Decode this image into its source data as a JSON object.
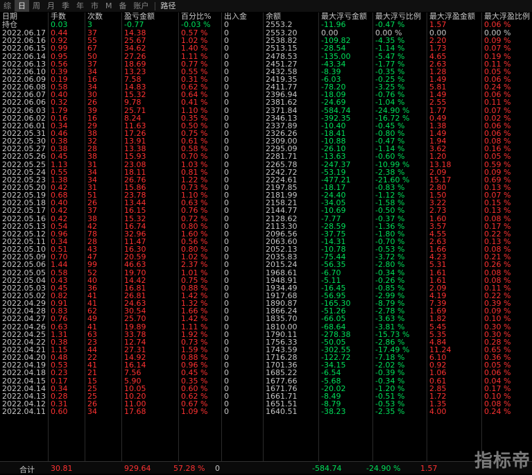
{
  "toolbar": {
    "periods": [
      {
        "label": "综",
        "active": false
      },
      {
        "label": "日",
        "active": true
      },
      {
        "label": "周",
        "active": false
      },
      {
        "label": "月",
        "active": false
      },
      {
        "label": "季",
        "active": false
      },
      {
        "label": "年",
        "active": false
      },
      {
        "label": "市",
        "active": false
      },
      {
        "label": "M",
        "active": false
      },
      {
        "label": "备",
        "active": false
      },
      {
        "label": "账户",
        "active": false
      }
    ],
    "path_label": "路径"
  },
  "headers": [
    "日期",
    "手数",
    "次数",
    "盈亏金额",
    "百分比%",
    "出入金",
    "余额",
    "最大浮亏金额",
    "最大浮亏比例",
    "最大浮盈金额",
    "最大浮盈比例"
  ],
  "holding": {
    "date": "持仓",
    "lots": "0.03",
    "count": "3",
    "pnl": "-0.77",
    "pct": "-0.03 %",
    "flow": "0",
    "balance": "2553.2",
    "max_loss": "-11.96",
    "max_loss_pct": "-0.47 %",
    "max_profit": "1.57",
    "max_profit_pct": "0.06 %"
  },
  "rows": [
    [
      "2022.06.17",
      "0.44",
      "37",
      "14.38",
      "0.57 %",
      "0",
      "2553.20",
      "0.00",
      "0.00 %",
      "0.00",
      "0.00 %"
    ],
    [
      "2022.06.16",
      "0.92",
      "55",
      "25.67",
      "1.02 %",
      "0",
      "2538.82",
      "-109.82",
      "-4.35 %",
      "2.20",
      "0.09 %"
    ],
    [
      "2022.06.15",
      "0.99",
      "67",
      "34.62",
      "1.40 %",
      "0",
      "2513.15",
      "-28.54",
      "-1.14 %",
      "1.73",
      "0.07 %"
    ],
    [
      "2022.06.14",
      "0.95",
      "50",
      "27.26",
      "1.11 %",
      "0",
      "2478.53",
      "-135.00",
      "-5.47 %",
      "4.65",
      "0.19 %"
    ],
    [
      "2022.06.13",
      "0.56",
      "37",
      "18.69",
      "0.77 %",
      "0",
      "2451.27",
      "-43.34",
      "-1.77 %",
      "2.63",
      "0.11 %"
    ],
    [
      "2022.06.10",
      "0.39",
      "34",
      "13.23",
      "0.55 %",
      "0",
      "2432.58",
      "-8.39",
      "-0.35 %",
      "1.28",
      "0.05 %"
    ],
    [
      "2022.06.09",
      "0.19",
      "16",
      "7.58",
      "0.31 %",
      "0",
      "2419.35",
      "-6.03",
      "-0.25 %",
      "1.49",
      "0.06 %"
    ],
    [
      "2022.06.08",
      "0.58",
      "34",
      "14.83",
      "0.62 %",
      "0",
      "2411.77",
      "-78.20",
      "-3.25 %",
      "5.81",
      "0.24 %"
    ],
    [
      "2022.06.07",
      "0.40",
      "30",
      "15.32",
      "0.64 %",
      "0",
      "2396.94",
      "-18.09",
      "-0.76 %",
      "1.49",
      "0.06 %"
    ],
    [
      "2022.06.06",
      "0.32",
      "26",
      "9.78",
      "0.41 %",
      "0",
      "2381.62",
      "-24.69",
      "-1.04 %",
      "2.55",
      "0.11 %"
    ],
    [
      "2022.06.03",
      "1.79",
      "39",
      "25.71",
      "1.10 %",
      "0",
      "2371.84",
      "-584.74",
      "-24.90 %",
      "1.77",
      "0.07 %"
    ],
    [
      "2022.06.02",
      "0.16",
      "16",
      "8.24",
      "0.35 %",
      "0",
      "2346.13",
      "-392.35",
      "-16.72 %",
      "0.49",
      "0.02 %"
    ],
    [
      "2022.06.01",
      "0.34",
      "29",
      "11.63",
      "0.50 %",
      "0",
      "2337.89",
      "-10.40",
      "-0.45 %",
      "1.38",
      "0.06 %"
    ],
    [
      "2022.05.31",
      "0.46",
      "38",
      "17.26",
      "0.75 %",
      "0",
      "2326.26",
      "-18.41",
      "-0.80 %",
      "1.49",
      "0.06 %"
    ],
    [
      "2022.05.30",
      "0.38",
      "32",
      "13.91",
      "0.61 %",
      "0",
      "2309.00",
      "-10.88",
      "-0.47 %",
      "1.94",
      "0.08 %"
    ],
    [
      "2022.05.27",
      "0.38",
      "28",
      "13.38",
      "0.58 %",
      "0",
      "2295.09",
      "-26.10",
      "-1.14 %",
      "3.62",
      "0.16 %"
    ],
    [
      "2022.05.26",
      "0.45",
      "38",
      "15.93",
      "0.70 %",
      "0",
      "2281.71",
      "-13.63",
      "-0.60 %",
      "1.20",
      "0.05 %"
    ],
    [
      "2022.05.25",
      "1.13",
      "31",
      "23.08",
      "1.03 %",
      "0",
      "2265.78",
      "-247.37",
      "-10.99 %",
      "13.18",
      "0.59 %"
    ],
    [
      "2022.05.24",
      "0.55",
      "34",
      "18.11",
      "0.81 %",
      "0",
      "2242.72",
      "-53.19",
      "-2.38 %",
      "2.09",
      "0.09 %"
    ],
    [
      "2022.05.23",
      "1.38",
      "34",
      "26.76",
      "1.22 %",
      "0",
      "2224.61",
      "-477.21",
      "-21.60 %",
      "15.17",
      "0.69 %"
    ],
    [
      "2022.05.20",
      "0.42",
      "31",
      "15.86",
      "0.73 %",
      "0",
      "2197.85",
      "-18.17",
      "-0.83 %",
      "2.80",
      "0.13 %"
    ],
    [
      "2022.05.19",
      "0.68",
      "51",
      "23.78",
      "1.10 %",
      "0",
      "2181.99",
      "-24.40",
      "-1.12 %",
      "1.50",
      "0.07 %"
    ],
    [
      "2022.05.18",
      "0.40",
      "26",
      "13.44",
      "0.63 %",
      "0",
      "2158.21",
      "-34.05",
      "-1.58 %",
      "3.22",
      "0.15 %"
    ],
    [
      "2022.05.17",
      "0.42",
      "37",
      "16.15",
      "0.76 %",
      "0",
      "2144.77",
      "-10.69",
      "-0.50 %",
      "2.73",
      "0.13 %"
    ],
    [
      "2022.05.16",
      "0.42",
      "38",
      "15.32",
      "0.72 %",
      "0",
      "2128.62",
      "-7.77",
      "-0.37 %",
      "1.60",
      "0.08 %"
    ],
    [
      "2022.05.13",
      "0.54",
      "42",
      "16.74",
      "0.80 %",
      "0",
      "2113.30",
      "-28.59",
      "-1.36 %",
      "3.57",
      "0.17 %"
    ],
    [
      "2022.05.12",
      "0.96",
      "78",
      "32.96",
      "1.60 %",
      "0",
      "2096.56",
      "-37.75",
      "-1.80 %",
      "4.55",
      "0.22 %"
    ],
    [
      "2022.05.11",
      "0.34",
      "28",
      "11.47",
      "0.56 %",
      "0",
      "2063.60",
      "-14.31",
      "-0.70 %",
      "2.63",
      "0.13 %"
    ],
    [
      "2022.05.10",
      "0.51",
      "43",
      "16.30",
      "0.80 %",
      "0",
      "2052.13",
      "-10.78",
      "-0.53 %",
      "1.66",
      "0.08 %"
    ],
    [
      "2022.05.09",
      "0.70",
      "47",
      "20.59",
      "1.02 %",
      "0",
      "2035.83",
      "-75.44",
      "-3.72 %",
      "4.23",
      "0.21 %"
    ],
    [
      "2022.05.06",
      "1.44",
      "99",
      "46.63",
      "2.37 %",
      "0",
      "2015.24",
      "-56.35",
      "-2.80 %",
      "5.31",
      "0.26 %"
    ],
    [
      "2022.05.05",
      "0.58",
      "52",
      "19.70",
      "1.01 %",
      "0",
      "1968.61",
      "-6.70",
      "-0.34 %",
      "1.61",
      "0.08 %"
    ],
    [
      "2022.05.04",
      "0.43",
      "40",
      "14.42",
      "0.75 %",
      "0",
      "1948.91",
      "-5.11",
      "-0.26 %",
      "1.61",
      "0.08 %"
    ],
    [
      "2022.05.03",
      "0.45",
      "36",
      "16.81",
      "0.88 %",
      "0",
      "1934.49",
      "-16.45",
      "-0.85 %",
      "2.09",
      "0.11 %"
    ],
    [
      "2022.05.02",
      "0.82",
      "41",
      "26.81",
      "1.42 %",
      "0",
      "1917.68",
      "-56.95",
      "-2.99 %",
      "4.19",
      "0.22 %"
    ],
    [
      "2022.04.29",
      "0.91",
      "41",
      "24.63",
      "1.32 %",
      "0",
      "1890.87",
      "-165.30",
      "-8.79 %",
      "7.39",
      "0.39 %"
    ],
    [
      "2022.04.28",
      "0.83",
      "62",
      "30.54",
      "1.66 %",
      "0",
      "1866.24",
      "-51.26",
      "-2.78 %",
      "1.69",
      "0.09 %"
    ],
    [
      "2022.04.27",
      "0.76",
      "49",
      "25.70",
      "1.42 %",
      "0",
      "1835.70",
      "-66.05",
      "-3.63 %",
      "1.82",
      "0.10 %"
    ],
    [
      "2022.04.26",
      "0.63",
      "41",
      "19.89",
      "1.11 %",
      "0",
      "1810.00",
      "-68.64",
      "-3.81 %",
      "5.45",
      "0.30 %"
    ],
    [
      "2022.04.25",
      "1.31",
      "63",
      "33.78",
      "1.92 %",
      "0",
      "1790.11",
      "-278.38",
      "-15.73 %",
      "5.35",
      "0.30 %"
    ],
    [
      "2022.04.22",
      "0.38",
      "23",
      "12.74",
      "0.73 %",
      "0",
      "1756.33",
      "-50.05",
      "-2.86 %",
      "4.84",
      "0.28 %"
    ],
    [
      "2022.04.21",
      "1.15",
      "44",
      "27.31",
      "1.59 %",
      "0",
      "1743.59",
      "-302.55",
      "-17.49 %",
      "11.24",
      "0.65 %"
    ],
    [
      "2022.04.20",
      "0.48",
      "22",
      "14.92",
      "0.88 %",
      "0",
      "1716.28",
      "-122.72",
      "-7.18 %",
      "6.10",
      "0.36 %"
    ],
    [
      "2022.04.19",
      "0.53",
      "41",
      "16.14",
      "0.96 %",
      "0",
      "1701.36",
      "-34.15",
      "-2.02 %",
      "0.92",
      "0.05 %"
    ],
    [
      "2022.04.18",
      "0.23",
      "21",
      "7.56",
      "0.45 %",
      "0",
      "1685.22",
      "-6.54",
      "-0.39 %",
      "1.06",
      "0.06 %"
    ],
    [
      "2022.04.15",
      "0.17",
      "15",
      "5.90",
      "0.35 %",
      "0",
      "1677.66",
      "-5.68",
      "-0.34 %",
      "0.61",
      "0.04 %"
    ],
    [
      "2022.04.14",
      "0.34",
      "25",
      "10.05",
      "0.60 %",
      "0",
      "1671.76",
      "-20.02",
      "-1.20 %",
      "2.85",
      "0.17 %"
    ],
    [
      "2022.04.13",
      "0.28",
      "25",
      "10.20",
      "0.62 %",
      "0",
      "1661.71",
      "-8.49",
      "-0.51 %",
      "1.72",
      "0.10 %"
    ],
    [
      "2022.04.12",
      "0.31",
      "26",
      "11.00",
      "0.67 %",
      "0",
      "1651.51",
      "-8.79",
      "-0.53 %",
      "1.35",
      "0.08 %"
    ],
    [
      "2022.04.11",
      "0.60",
      "34",
      "17.68",
      "1.09 %",
      "0",
      "1640.51",
      "-38.23",
      "-2.35 %",
      "4.00",
      "0.24 %"
    ]
  ],
  "totals": {
    "label": "合计",
    "lots": "30.81",
    "pnl": "929.64",
    "pct": "57.28 %",
    "flow": "0",
    "max_loss": "-584.74",
    "max_loss_pct": "-24.90 %",
    "max_profit": "1.57"
  },
  "watermark": "指标帝",
  "colors": {
    "up": "#ff3232",
    "down": "#00e05a",
    "text": "#c8c8c8",
    "background": "#000000"
  }
}
